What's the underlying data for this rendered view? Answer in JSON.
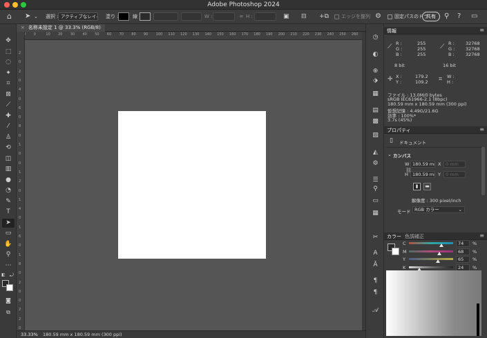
{
  "window": {
    "title": "Adobe Photoshop 2024",
    "traffic_colors": [
      "#ff5f57",
      "#febc2e",
      "#28c840"
    ]
  },
  "options_bar": {
    "home_icon": "home-icon",
    "select_label": "選択 :",
    "select_value": "アクティブなレイ-",
    "fill_label": "塗り :",
    "stroke_label": "線 :",
    "w_label": "W :",
    "h_label": "H :",
    "align_edges": "エッジを整列",
    "fixed_path": "固定パスのドラ",
    "share": "共有"
  },
  "document": {
    "tab_label": "名称未設定 1 @ 33.3% (RGB/8)",
    "zoom": "33.33%",
    "size_info": "180.59 mm x 180.59 mm (300 ppi)"
  },
  "rulers": {
    "horizontal": [
      "10",
      "0",
      "10",
      "20",
      "30",
      "40",
      "50",
      "60",
      "70",
      "80",
      "90",
      "100",
      "110",
      "120",
      "130",
      "140",
      "150",
      "160",
      "170",
      "180",
      "190",
      "200",
      "210",
      "220",
      "230",
      "240",
      "250",
      "260",
      "270"
    ],
    "vertical": [
      "2",
      "0",
      "2",
      "0",
      "4",
      "0",
      "6",
      "0",
      "8",
      "0",
      "1",
      "0",
      "0",
      "1",
      "2",
      "0",
      "1",
      "4",
      "0",
      "1",
      "6",
      "0",
      "1",
      "8",
      "0",
      "2",
      "0",
      "0",
      "2",
      "2",
      "0"
    ]
  },
  "info_panel": {
    "tab": "情報",
    "r_label": "R :",
    "g_label": "G :",
    "b_label": "B :",
    "rgb1": [
      "255",
      "255",
      "255"
    ],
    "rgb2": [
      "32768",
      "32768",
      "32768"
    ],
    "bit1": "8 bit",
    "bit2": "16 bit",
    "x_label": "X :",
    "y_label": "Y :",
    "x_val": "179.2",
    "y_val": "109.2",
    "w_label": "W :",
    "h_label": "H :",
    "file_lines": [
      "ファイル : 13.0M/0 bytes",
      "sRGB IEC61966-2.1 (8bpc)",
      "180.59 mm x 180.59 mm (300 ppi)",
      "仮想記憶 : 4.49G/21.6G",
      "効率 : 100%*",
      "3.7s (45%)"
    ]
  },
  "properties_panel": {
    "tab": "プロパティ",
    "doc_label": "ドキュメント",
    "canvas_section": "カンバス",
    "w_label": "W",
    "w_value": "180.59 mr",
    "h_label": "H",
    "h_value": "180.59 mr",
    "x_label": "X",
    "x_placeholder": "0 mm",
    "y_label": "Y",
    "y_placeholder": "0 mm",
    "resolution": "解像度 : 300 pixel/inch",
    "mode_label": "モード",
    "mode_value": "RGB カラー"
  },
  "color_panel": {
    "tab1": "カラー",
    "tab2": "色調補正",
    "channels": [
      {
        "label": "C",
        "value": "74",
        "unit": "%",
        "level": 0.74
      },
      {
        "label": "M",
        "value": "68",
        "unit": "%",
        "level": 0.68
      },
      {
        "label": "Y",
        "value": "65",
        "unit": "%",
        "level": 0.65
      },
      {
        "label": "K",
        "value": "24",
        "unit": "%",
        "level": 0.24
      }
    ]
  },
  "tools": [
    "move-icon",
    "marquee-icon",
    "lasso-icon",
    "magic-wand-icon",
    "crop-icon",
    "frame-icon",
    "eyedropper-icon",
    "healing-brush-icon",
    "brush-icon",
    "clone-stamp-icon",
    "history-brush-icon",
    "eraser-icon",
    "gradient-icon",
    "blur-icon",
    "dodge-icon",
    "pen-icon",
    "type-icon",
    "path-selection-icon",
    "rectangle-icon",
    "hand-icon",
    "zoom-icon",
    "more-tools-icon"
  ],
  "tool_glyphs": [
    "✥",
    "⬚",
    "◌",
    "✦",
    "⌗",
    "⊠",
    "⟋",
    "✚",
    "⁄",
    "♙",
    "⟲",
    "◫",
    "▥",
    "●",
    "◔",
    "✎",
    "T",
    "➤",
    "▭",
    "✋",
    "⚲",
    "⋯"
  ],
  "side_icons": [
    "history-icon",
    "color-wheel-icon",
    "layers-comp-icon",
    "paint-icon",
    "layers-icon",
    "channels-icon",
    "paths-icon",
    "adjustments-icon",
    "actions-icon",
    "properties-icon",
    "sliders-icon",
    "adjust-icon",
    "notes-icon",
    "table-icon",
    "transform-icon",
    "character-icon",
    "glyph-icon",
    "paragraph-icon",
    "paragraph-style-icon",
    "script-icon"
  ],
  "side_glyphs": [
    "◷",
    "◐",
    "⊕",
    "⬗",
    "▦",
    "▤",
    "▩",
    "▧",
    "◭",
    "⚙",
    "☰",
    "⚲",
    "▭",
    "▦",
    "✂",
    "A",
    "Ā",
    "¶",
    "¶",
    "𝒜"
  ]
}
